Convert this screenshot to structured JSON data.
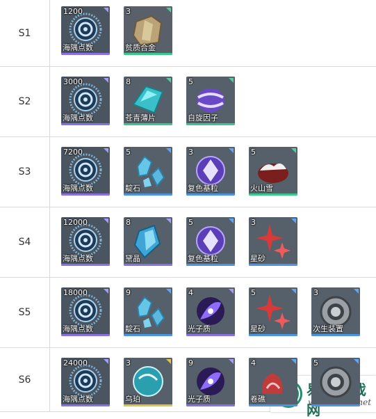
{
  "rows": [
    {
      "label": "S1",
      "items": [
        {
          "count": "1200",
          "name": "海隅点数",
          "icon": "coin-icon",
          "rarity": "purple"
        },
        {
          "count": "3",
          "name": "贫质合金",
          "icon": "alloy-icon",
          "rarity": "green"
        }
      ]
    },
    {
      "label": "S2",
      "items": [
        {
          "count": "3000",
          "name": "海隅点数",
          "icon": "coin-icon",
          "rarity": "purple"
        },
        {
          "count": "8",
          "name": "苍青薄片",
          "icon": "shard-icon",
          "rarity": "green"
        },
        {
          "count": "5",
          "name": "自旋因子",
          "icon": "spin-icon",
          "rarity": "green"
        }
      ]
    },
    {
      "label": "S3",
      "items": [
        {
          "count": "7200",
          "name": "海隅点数",
          "icon": "coin-icon",
          "rarity": "purple"
        },
        {
          "count": "5",
          "name": "靛石",
          "icon": "indigo-stone-icon",
          "rarity": "blue"
        },
        {
          "count": "3",
          "name": "复色基粒",
          "icon": "crystal-ball-icon",
          "rarity": "blue"
        },
        {
          "count": "5",
          "name": "火山雪",
          "icon": "volcano-snow-icon",
          "rarity": "green"
        }
      ]
    },
    {
      "label": "S4",
      "items": [
        {
          "count": "12000",
          "name": "海隅点数",
          "icon": "coin-icon",
          "rarity": "purple"
        },
        {
          "count": "8",
          "name": "黛晶",
          "icon": "dark-crystal-icon",
          "rarity": "purple"
        },
        {
          "count": "5",
          "name": "复色基粒",
          "icon": "crystal-ball-icon",
          "rarity": "blue"
        },
        {
          "count": "3",
          "name": "星砂",
          "icon": "star-sand-icon",
          "rarity": "blue"
        }
      ]
    },
    {
      "label": "S5",
      "items": [
        {
          "count": "18000",
          "name": "海隅点数",
          "icon": "coin-icon",
          "rarity": "purple"
        },
        {
          "count": "9",
          "name": "靛石",
          "icon": "indigo-stone-icon",
          "rarity": "blue"
        },
        {
          "count": "4",
          "name": "光子质",
          "icon": "photon-icon",
          "rarity": "purple"
        },
        {
          "count": "5",
          "name": "星砂",
          "icon": "star-sand-icon",
          "rarity": "blue"
        },
        {
          "count": "3",
          "name": "次生装置",
          "icon": "device-icon",
          "rarity": "blue"
        }
      ]
    },
    {
      "label": "S6",
      "items": [
        {
          "count": "24000",
          "name": "海隅点数",
          "icon": "coin-icon",
          "rarity": "purple"
        },
        {
          "count": "3",
          "name": "乌珀",
          "icon": "amber-icon",
          "rarity": "gold"
        },
        {
          "count": "9",
          "name": "光子质",
          "icon": "photon-icon",
          "rarity": "purple"
        },
        {
          "count": "4",
          "name": "卷礁",
          "icon": "reef-icon",
          "rarity": "blue"
        },
        {
          "count": "5",
          "name": "",
          "icon": "device-icon",
          "rarity": "blue"
        }
      ]
    }
  ],
  "watermark": {
    "title": "易采游戏网",
    "url": "www.easck.net"
  }
}
